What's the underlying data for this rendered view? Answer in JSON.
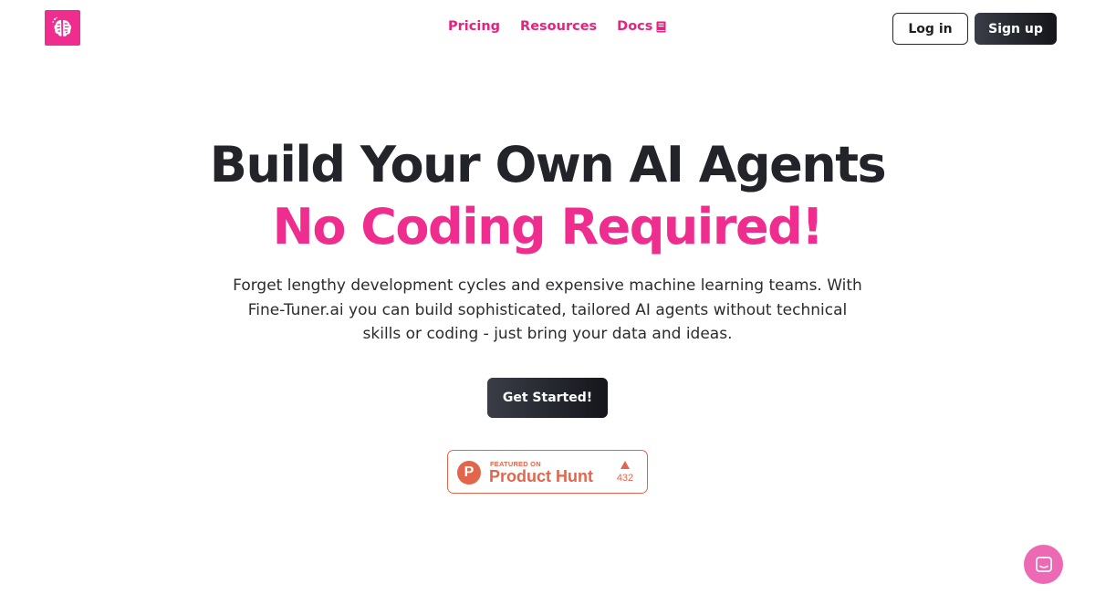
{
  "header": {
    "nav": [
      {
        "label": "Pricing"
      },
      {
        "label": "Resources"
      },
      {
        "label": "Docs"
      }
    ],
    "login_label": "Log in",
    "signup_label": "Sign up"
  },
  "hero": {
    "title": "Build Your Own AI Agents",
    "accent": "No Coding Required!",
    "description": "Forget lengthy development cycles and expensive machine learning teams. With Fine-Tuner.ai you can build sophisticated, tailored AI agents without technical skills or coding - just bring your data and ideas.",
    "cta_label": "Get Started!"
  },
  "product_hunt": {
    "featured_label": "FEATURED ON",
    "name": "Product Hunt",
    "logo_letter": "P",
    "upvotes": "432"
  },
  "colors": {
    "brand_pink": "#ee2d8e",
    "nav_pink": "#e4247f",
    "dark_button": "#1f2027",
    "product_hunt_orange": "#e2664c",
    "chat_pink": "#ee69b4"
  },
  "icons": {
    "logo": "brain-icon",
    "docs": "book-icon",
    "chat": "chat-bubble-icon",
    "upvote": "triangle-up-icon"
  }
}
